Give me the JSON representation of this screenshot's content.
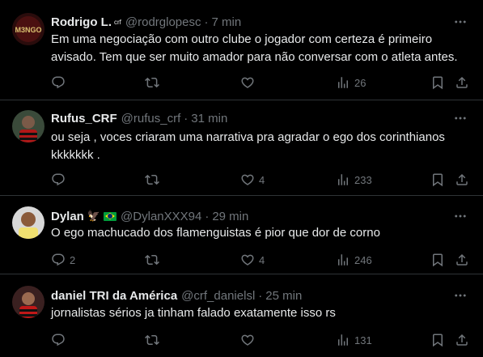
{
  "tweets": [
    {
      "name": "Rodrigo L.",
      "name_badge": "crf",
      "handle": "@rodrglopesc",
      "time": "7 min",
      "text": "Em uma negociação com outro clube o jogador com certeza é primeiro avisado. Tem que ser muito amador para não conversar com o atleta antes.",
      "replies": "",
      "retweets": "",
      "likes": "",
      "views": "26",
      "avatar_text": "M3NGO"
    },
    {
      "name": "Rufus_CRF",
      "handle": "@rufus_crf",
      "time": "31 min",
      "text": "ou seja , voces criaram uma narrativa pra agradar o ego dos corinthianos kkkkkkk .",
      "replies": "",
      "retweets": "",
      "likes": "4",
      "views": "233"
    },
    {
      "name": "Dylan",
      "name_emoji": "🦅",
      "handle": "@DylanXXX94",
      "time": "29 min",
      "text": "O ego machucado dos flamenguistas é pior que dor de corno",
      "replies": "2",
      "retweets": "",
      "likes": "4",
      "views": "246"
    },
    {
      "name": "daniel TRI da América",
      "handle": "@crf_danielsl",
      "time": "25 min",
      "text": "jornalistas sérios ja tinham falado exatamente isso rs",
      "replies": "",
      "retweets": "",
      "likes": "",
      "views": "131"
    }
  ],
  "icons": {
    "reply": "reply-icon",
    "retweet": "retweet-icon",
    "like": "heart-icon",
    "views": "views-icon",
    "bookmark": "bookmark-icon",
    "share": "share-icon",
    "more": "more-icon"
  },
  "colors": {
    "background": "#000000",
    "text": "#e7e9ea",
    "secondary": "#71767b",
    "divider": "#2f3336"
  }
}
